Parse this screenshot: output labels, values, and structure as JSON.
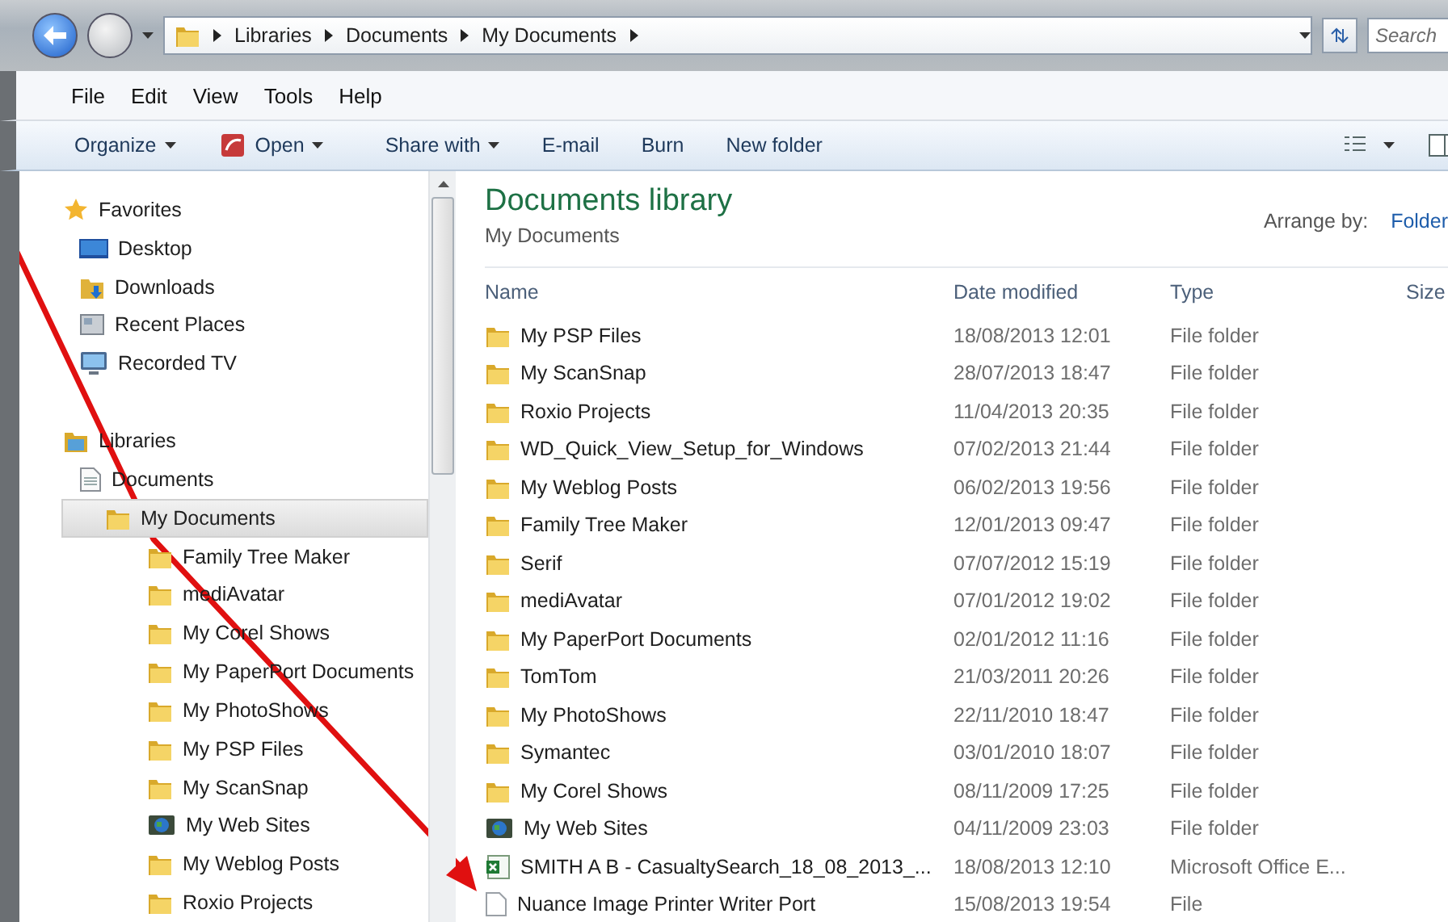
{
  "address_bar": {
    "breadcrumbs": [
      "Libraries",
      "Documents",
      "My Documents"
    ],
    "search": {
      "placeholder": "Search"
    }
  },
  "menu_bar": [
    "File",
    "Edit",
    "View",
    "Tools",
    "Help"
  ],
  "toolbar": [
    {
      "label": "Organize",
      "dropdown": true,
      "kind": "plain"
    },
    {
      "label": "Open",
      "dropdown": true,
      "kind": "open"
    },
    {
      "label": "Share with",
      "dropdown": true,
      "kind": "plain"
    },
    {
      "label": "E-mail",
      "dropdown": false,
      "kind": "plain"
    },
    {
      "label": "Burn",
      "dropdown": false,
      "kind": "plain"
    },
    {
      "label": "New folder",
      "dropdown": false,
      "kind": "plain"
    }
  ],
  "sidebar": {
    "items": [
      {
        "label": "Favorites",
        "kind": "star",
        "selected": false,
        "children": [
          {
            "label": "Desktop",
            "kind": "desktop",
            "selected": false
          },
          {
            "label": "Downloads",
            "kind": "downloads",
            "selected": false
          },
          {
            "label": "Recent Places",
            "kind": "recent",
            "selected": false
          },
          {
            "label": "Recorded TV",
            "kind": "tv",
            "selected": false
          }
        ]
      },
      {
        "label": "Libraries",
        "kind": "library",
        "selected": false,
        "children": [
          {
            "label": "Documents",
            "kind": "document",
            "selected": false,
            "children": [
              {
                "label": "My Documents",
                "kind": "folder",
                "selected": true,
                "children": [
                  {
                    "label": "Family Tree Maker",
                    "kind": "folder",
                    "selected": false
                  },
                  {
                    "label": "mediAvatar",
                    "kind": "folder",
                    "selected": false
                  },
                  {
                    "label": "My Corel Shows",
                    "kind": "folder",
                    "selected": false
                  },
                  {
                    "label": "My PaperPort Documents",
                    "kind": "folder",
                    "selected": false
                  },
                  {
                    "label": "My PhotoShows",
                    "kind": "folder",
                    "selected": false
                  },
                  {
                    "label": "My PSP Files",
                    "kind": "folder",
                    "selected": false
                  },
                  {
                    "label": "My ScanSnap",
                    "kind": "folder",
                    "selected": false
                  },
                  {
                    "label": "My Web Sites",
                    "kind": "web",
                    "selected": false
                  },
                  {
                    "label": "My Weblog Posts",
                    "kind": "folder",
                    "selected": false
                  },
                  {
                    "label": "Roxio Projects",
                    "kind": "folder",
                    "selected": false
                  }
                ]
              }
            ]
          }
        ]
      }
    ]
  },
  "library": {
    "title": "Documents library",
    "subtitle": "My Documents",
    "arrange_label": "Arrange by:",
    "arrange_value": "Folder"
  },
  "table": {
    "columns": [
      "Name",
      "Date modified",
      "Type",
      "Size"
    ],
    "rows": [
      {
        "name": "My PSP Files",
        "date": "18/08/2013 12:01",
        "type": "File folder",
        "kind": "folder"
      },
      {
        "name": "My ScanSnap",
        "date": "28/07/2013 18:47",
        "type": "File folder",
        "kind": "folder"
      },
      {
        "name": "Roxio Projects",
        "date": "11/04/2013 20:35",
        "type": "File folder",
        "kind": "folder"
      },
      {
        "name": "WD_Quick_View_Setup_for_Windows",
        "date": "07/02/2013 21:44",
        "type": "File folder",
        "kind": "folder"
      },
      {
        "name": "My Weblog Posts",
        "date": "06/02/2013 19:56",
        "type": "File folder",
        "kind": "folder"
      },
      {
        "name": "Family Tree Maker",
        "date": "12/01/2013 09:47",
        "type": "File folder",
        "kind": "folder"
      },
      {
        "name": "Serif",
        "date": "07/07/2012 15:19",
        "type": "File folder",
        "kind": "folder"
      },
      {
        "name": "mediAvatar",
        "date": "07/01/2012 19:02",
        "type": "File folder",
        "kind": "folder"
      },
      {
        "name": "My PaperPort Documents",
        "date": "02/01/2012 11:16",
        "type": "File folder",
        "kind": "folder"
      },
      {
        "name": "TomTom",
        "date": "21/03/2011 20:26",
        "type": "File folder",
        "kind": "folder"
      },
      {
        "name": "My PhotoShows",
        "date": "22/11/2010 18:47",
        "type": "File folder",
        "kind": "folder"
      },
      {
        "name": "Symantec",
        "date": "03/01/2010 18:07",
        "type": "File folder",
        "kind": "folder"
      },
      {
        "name": "My Corel Shows",
        "date": "08/11/2009 17:25",
        "type": "File folder",
        "kind": "folder"
      },
      {
        "name": "My Web Sites",
        "date": "04/11/2009 23:03",
        "type": "File folder",
        "kind": "web"
      },
      {
        "name": "SMITH A B - CasualtySearch_18_08_2013_...",
        "date": "18/08/2013 12:10",
        "type": "Microsoft Office E...",
        "kind": "excel"
      },
      {
        "name": "Nuance Image Printer Writer Port",
        "date": "15/08/2013 19:54",
        "type": "File",
        "kind": "file"
      }
    ]
  }
}
